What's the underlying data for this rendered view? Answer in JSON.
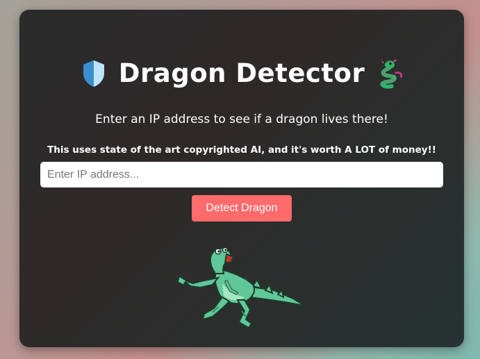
{
  "header": {
    "title": "Dragon Detector",
    "left_icon": "shield-icon",
    "right_icon": "dragon-emoji-icon"
  },
  "main": {
    "subtitle": "Enter an IP address to see if a dragon lives there!",
    "note": "This uses state of the art copyrighted AI, and it's worth A LOT of money!!",
    "ip_input": {
      "value": "",
      "placeholder": "Enter IP address..."
    },
    "detect_button": "Detect Dragon",
    "illustration": "running-dragon-pixel-art"
  },
  "colors": {
    "card_background": "#2b2b2b",
    "button": "#ff6b6b",
    "dragon_green": "#5fc79a"
  }
}
